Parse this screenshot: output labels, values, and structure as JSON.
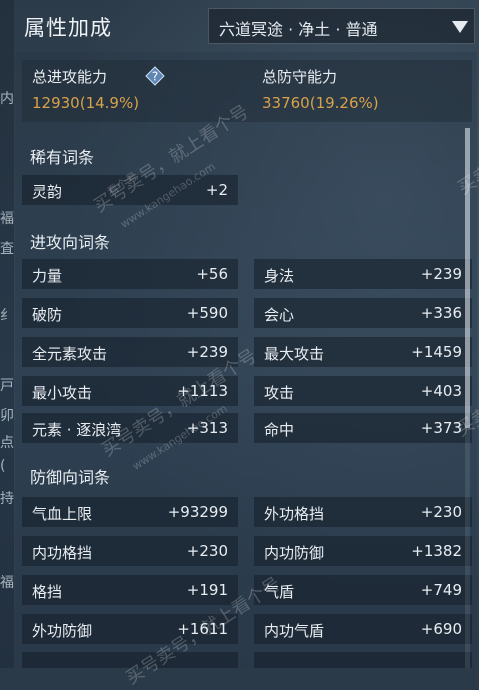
{
  "header": {
    "title": "属性加成",
    "dropdown_value": "六道冥途 · 净土 · 普通"
  },
  "summary": {
    "attack_label": "总进攻能力",
    "attack_value": "12930(14.9%)",
    "defense_label": "总防守能力",
    "defense_value": "33760(19.26%)"
  },
  "sections": {
    "rare_title": "稀有词条",
    "rare_items": [
      {
        "name": "灵韵",
        "value": "+2"
      }
    ],
    "attack_title": "进攻向词条",
    "attack_items": [
      {
        "name": "力量",
        "value": "+56"
      },
      {
        "name": "身法",
        "value": "+239"
      },
      {
        "name": "破防",
        "value": "+590"
      },
      {
        "name": "会心",
        "value": "+336"
      },
      {
        "name": "全元素攻击",
        "value": "+239"
      },
      {
        "name": "最大攻击",
        "value": "+1459"
      },
      {
        "name": "最小攻击",
        "value": "+1113"
      },
      {
        "name": "攻击",
        "value": "+403"
      },
      {
        "name": "元素 · 逐浪湾",
        "value": "+313"
      },
      {
        "name": "命中",
        "value": "+373"
      }
    ],
    "defense_title": "防御向词条",
    "defense_items": [
      {
        "name": "气血上限",
        "value": "+93299"
      },
      {
        "name": "外功格挡",
        "value": "+230"
      },
      {
        "name": "内功格挡",
        "value": "+230"
      },
      {
        "name": "内功防御",
        "value": "+1382"
      },
      {
        "name": "格挡",
        "value": "+191"
      },
      {
        "name": "气盾",
        "value": "+749"
      },
      {
        "name": "外功防御",
        "value": "+1611"
      },
      {
        "name": "内功气盾",
        "value": "+690"
      }
    ]
  },
  "edge_chars": [
    "内",
    "褔",
    "査",
    "纟",
    "戸",
    "卯",
    "点",
    "(",
    "持",
    "福"
  ],
  "watermarks": {
    "main": "买号卖号，就上看个号",
    "site": "www.kangehao.com",
    "badge": "看个号",
    "side": "买卖"
  },
  "colors": {
    "accent_gold": "#d8a24a",
    "row_bg": "#1e2a36",
    "text": "#e8edf2"
  }
}
